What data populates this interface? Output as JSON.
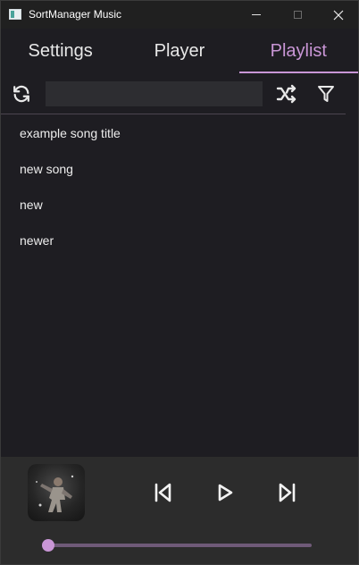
{
  "window": {
    "title": "SortManager Music"
  },
  "tabs": [
    {
      "label": "Settings",
      "active": false
    },
    {
      "label": "Player",
      "active": false
    },
    {
      "label": "Playlist",
      "active": true
    }
  ],
  "toolbar": {
    "search_value": "",
    "search_placeholder": ""
  },
  "playlist": {
    "songs": [
      "example song title",
      "new song",
      "new",
      "newer"
    ]
  },
  "player": {
    "progress": 0.0
  },
  "colors": {
    "accent": "#c996d6",
    "background": "#1e1d22",
    "player_bar": "#2c2c2c"
  },
  "icons": [
    "refresh-icon",
    "shuffle-icon",
    "filter-icon",
    "skip-previous-icon",
    "play-icon",
    "skip-next-icon",
    "minimize-icon",
    "maximize-icon",
    "close-icon"
  ]
}
